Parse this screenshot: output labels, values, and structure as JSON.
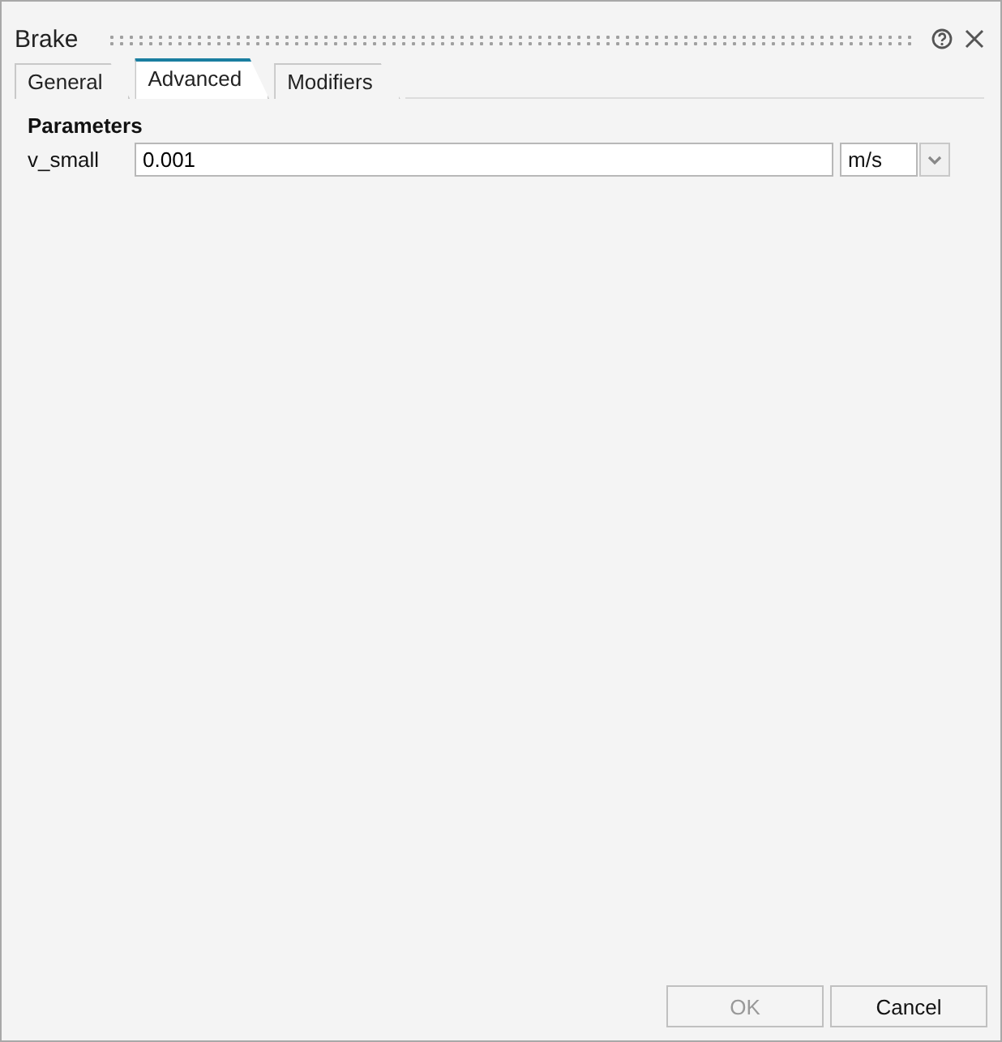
{
  "window": {
    "title": "Brake"
  },
  "tabs": [
    {
      "label": "General",
      "selected": false
    },
    {
      "label": "Advanced",
      "selected": true
    },
    {
      "label": "Modifiers",
      "selected": false
    }
  ],
  "section": {
    "title": "Parameters"
  },
  "fields": [
    {
      "label": "v_small",
      "value": "0.001",
      "unit": "m/s"
    }
  ],
  "buttons": [
    {
      "label": "OK",
      "disabled": true
    },
    {
      "label": "Cancel",
      "disabled": false
    }
  ]
}
